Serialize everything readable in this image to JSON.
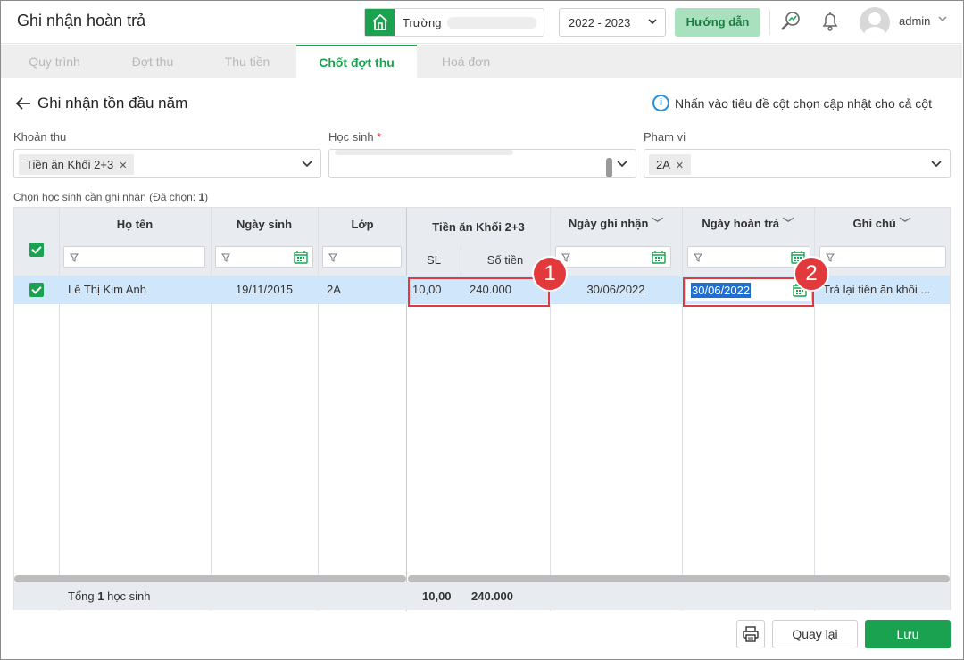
{
  "header": {
    "title": "Ghi nhận hoàn trả",
    "school_label": "Trường",
    "year": "2022 - 2023",
    "guide_label": "Hướng dẫn",
    "user": "admin"
  },
  "tabs": [
    "Quy trình",
    "Đợt thu",
    "Thu tiền",
    "Chốt đợt thu",
    "Hoá đơn"
  ],
  "page": {
    "back_label": "Ghi nhận tồn đầu năm",
    "hint": "Nhấn vào tiêu đề cột chọn cập nhật cho cả cột"
  },
  "filters": {
    "fee_label": "Khoản thu",
    "fee_value": "Tiền ăn Khối 2+3",
    "student_label": "Học sinh",
    "student_required": "*",
    "scope_label": "Phạm vi",
    "scope_value": "2A"
  },
  "selection_note_prefix": "Chọn học sinh cần ghi nhận (Đã chọn: ",
  "selection_count": "1",
  "selection_note_suffix": ")",
  "table": {
    "col_name": "Họ tên",
    "col_dob": "Ngày sinh",
    "col_class": "Lớp",
    "col_fee_group": "Tiền ăn Khối 2+3",
    "col_qty": "SL",
    "col_amount": "Số tiền",
    "col_record_date": "Ngày ghi nhận",
    "col_refund_date": "Ngày hoàn trả",
    "col_note": "Ghi chú",
    "rows": [
      {
        "name": "Lê Thị Kim Anh",
        "dob": "19/11/2015",
        "class": "2A",
        "qty": "10,00",
        "amount": "240.000",
        "record_date": "30/06/2022",
        "refund_date": "30/06/2022",
        "note": "Trả lại tiền ăn khối ..."
      }
    ],
    "footer": {
      "total_prefix": "Tổng ",
      "total_count": "1",
      "total_suffix": " học sinh",
      "qty_total": "10,00",
      "amount_total": "240.000"
    }
  },
  "callouts": [
    "1",
    "2"
  ],
  "buttons": {
    "back": "Quay lại",
    "save": "Lưu"
  },
  "colors": {
    "brand_green": "#1aa251",
    "callout_red": "#e2393d",
    "selected_row": "#cfe6fb"
  }
}
